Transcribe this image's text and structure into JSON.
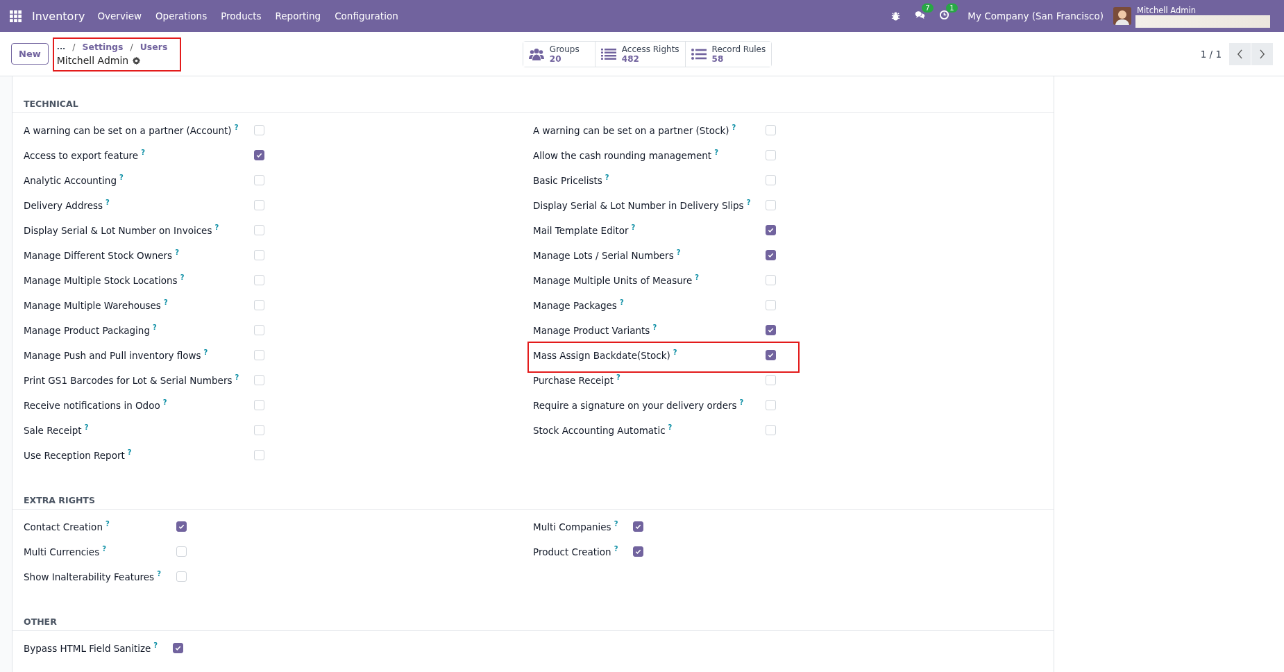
{
  "navbar": {
    "app_name": "Inventory",
    "menu": [
      "Overview",
      "Operations",
      "Products",
      "Reporting",
      "Configuration"
    ],
    "messages_badge": "7",
    "activities_badge": "1",
    "company": "My Company (San Francisco)",
    "user": "Mitchell Admin"
  },
  "control_panel": {
    "new_button": "New",
    "breadcrumb": {
      "highlighted": true,
      "items": [
        {
          "kind": "link",
          "text": "..."
        },
        {
          "kind": "separator",
          "text": "/"
        },
        {
          "kind": "link",
          "text": "Settings"
        },
        {
          "kind": "separator",
          "text": "/"
        },
        {
          "kind": "link",
          "text": "Users"
        }
      ],
      "title": "Mitchell Admin"
    },
    "stat_buttons": [
      {
        "kind": "groups",
        "label": "Groups",
        "value": "20"
      },
      {
        "kind": "list",
        "label": "Access Rights",
        "value": "482"
      },
      {
        "kind": "rules",
        "label": "Record Rules",
        "value": "58"
      }
    ],
    "pager": "1 / 1"
  },
  "sections": [
    {
      "title": "TECHNICAL",
      "columns": [
        [
          {
            "label": "A warning can be set on a partner (Account)",
            "tip": "?",
            "checked": false,
            "highlighted": false
          },
          {
            "label": "Access to export feature",
            "tip": "?",
            "checked": true,
            "highlighted": false
          },
          {
            "label": "Analytic Accounting",
            "tip": "?",
            "checked": false,
            "highlighted": false
          },
          {
            "label": "Delivery Address",
            "tip": "?",
            "checked": false,
            "highlighted": false
          },
          {
            "label": "Display Serial & Lot Number on Invoices",
            "tip": "?",
            "checked": false,
            "highlighted": false
          },
          {
            "label": "Manage Different Stock Owners",
            "tip": "?",
            "checked": false,
            "highlighted": false
          },
          {
            "label": "Manage Multiple Stock Locations",
            "tip": "?",
            "checked": false,
            "highlighted": false
          },
          {
            "label": "Manage Multiple Warehouses",
            "tip": "?",
            "checked": false,
            "highlighted": false
          },
          {
            "label": "Manage Product Packaging",
            "tip": "?",
            "checked": false,
            "highlighted": false
          },
          {
            "label": "Manage Push and Pull inventory flows",
            "tip": "?",
            "checked": false,
            "highlighted": false
          },
          {
            "label": "Print GS1 Barcodes for Lot & Serial Numbers",
            "tip": "?",
            "checked": false,
            "highlighted": false
          },
          {
            "label": "Receive notifications in Odoo",
            "tip": "?",
            "checked": false,
            "highlighted": false
          },
          {
            "label": "Sale Receipt",
            "tip": "?",
            "checked": false,
            "highlighted": false
          },
          {
            "label": "Use Reception Report",
            "tip": "?",
            "checked": false,
            "highlighted": false
          }
        ],
        [
          {
            "label": "A warning can be set on a partner (Stock)",
            "tip": "?",
            "checked": false,
            "highlighted": false
          },
          {
            "label": "Allow the cash rounding management",
            "tip": "?",
            "checked": false,
            "highlighted": false
          },
          {
            "label": "Basic Pricelists",
            "tip": "?",
            "checked": false,
            "highlighted": false
          },
          {
            "label": "Display Serial & Lot Number in Delivery Slips",
            "tip": "?",
            "checked": false,
            "highlighted": false
          },
          {
            "label": "Mail Template Editor",
            "tip": "?",
            "checked": true,
            "highlighted": false
          },
          {
            "label": "Manage Lots / Serial Numbers",
            "tip": "?",
            "checked": true,
            "highlighted": false
          },
          {
            "label": "Manage Multiple Units of Measure",
            "tip": "?",
            "checked": false,
            "highlighted": false
          },
          {
            "label": "Manage Packages",
            "tip": "?",
            "checked": false,
            "highlighted": false
          },
          {
            "label": "Manage Product Variants",
            "tip": "?",
            "checked": true,
            "highlighted": false
          },
          {
            "label": "Mass Assign Backdate(Stock)",
            "tip": "?",
            "checked": true,
            "highlighted": true
          },
          {
            "label": "Purchase Receipt",
            "tip": "?",
            "checked": false,
            "highlighted": false
          },
          {
            "label": "Require a signature on your delivery orders",
            "tip": "?",
            "checked": false,
            "highlighted": false
          },
          {
            "label": "Stock Accounting Automatic",
            "tip": "?",
            "checked": false,
            "highlighted": false
          }
        ]
      ]
    },
    {
      "title": "EXTRA RIGHTS",
      "columns": [
        [
          {
            "label": "Contact Creation",
            "tip": "?",
            "checked": true,
            "highlighted": false
          },
          {
            "label": "Multi Currencies",
            "tip": "?",
            "checked": false,
            "highlighted": false
          },
          {
            "label": "Show Inalterability Features",
            "tip": "?",
            "checked": false,
            "highlighted": false
          }
        ],
        [
          {
            "label": "Multi Companies",
            "tip": "?",
            "checked": true,
            "highlighted": false
          },
          {
            "label": "Product Creation",
            "tip": "?",
            "checked": true,
            "highlighted": false
          }
        ]
      ]
    },
    {
      "title": "OTHER",
      "columns": [
        [
          {
            "label": "Bypass HTML Field Sanitize",
            "tip": "?",
            "checked": true,
            "highlighted": false
          }
        ]
      ]
    }
  ]
}
